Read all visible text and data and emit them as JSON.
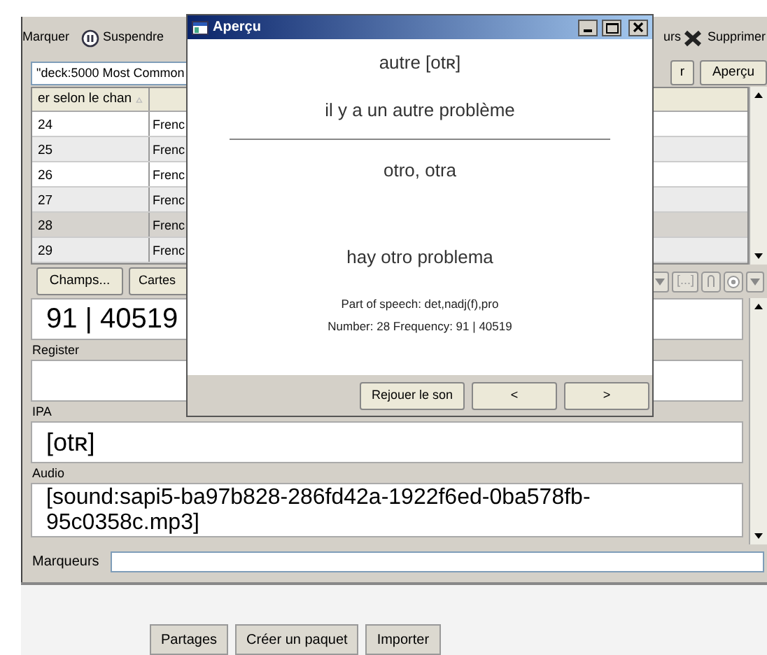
{
  "toolbar": {
    "left": [
      {
        "label": "Marquer"
      },
      {
        "label": "Suspendre"
      }
    ],
    "right": [
      {
        "label": "urs"
      },
      {
        "label": "Supprimer"
      }
    ]
  },
  "search": {
    "value": "\"deck:5000 Most Common"
  },
  "search_buttons": [
    "r",
    "Aperçu"
  ],
  "table": {
    "columns": [
      {
        "label": "er selon le chan",
        "sorted": true
      }
    ],
    "rows": [
      {
        "cells": [
          "24",
          "Frenc"
        ],
        "selected": false
      },
      {
        "cells": [
          "25",
          "Frenc"
        ],
        "selected": false
      },
      {
        "cells": [
          "26",
          "Frenc"
        ],
        "selected": false
      },
      {
        "cells": [
          "27",
          "Frenc"
        ],
        "selected": false
      },
      {
        "cells": [
          "28",
          "Frenc"
        ],
        "selected": true
      },
      {
        "cells": [
          "29",
          "Frenc"
        ],
        "selected": false
      }
    ]
  },
  "editor_buttons": [
    "Champs...",
    "Cartes"
  ],
  "editor_tools": {
    "cloze": "[...]"
  },
  "fields": [
    {
      "kind": "large",
      "value": "91 | 40519"
    },
    {
      "kind": "normal",
      "label": "Register"
    },
    {
      "kind": "medium",
      "label": "IPA",
      "value": "[otʀ]"
    },
    {
      "kind": "normal",
      "label": "Audio",
      "value": "[sound:sapi5-ba97b828-286fd42a-1922f6ed-0ba578fb-95c0358c.mp3]"
    }
  ],
  "tags": {
    "label": "Marqueurs"
  },
  "bottom_buttons": [
    "Partages",
    "Créer un paquet",
    "Importer"
  ],
  "dialog": {
    "title": "Aperçu",
    "front": {
      "word": "autre [otʀ]",
      "sentence": "il y a un autre problème"
    },
    "back": {
      "word": "otro, otra",
      "sentence": "hay otro problema",
      "notes": [
        "Part of speech: det,nadj(f),pro",
        "Number: 28 Frequency: 91 | 40519"
      ]
    },
    "buttons": [
      "Rejouer le son",
      "<",
      ">"
    ]
  }
}
